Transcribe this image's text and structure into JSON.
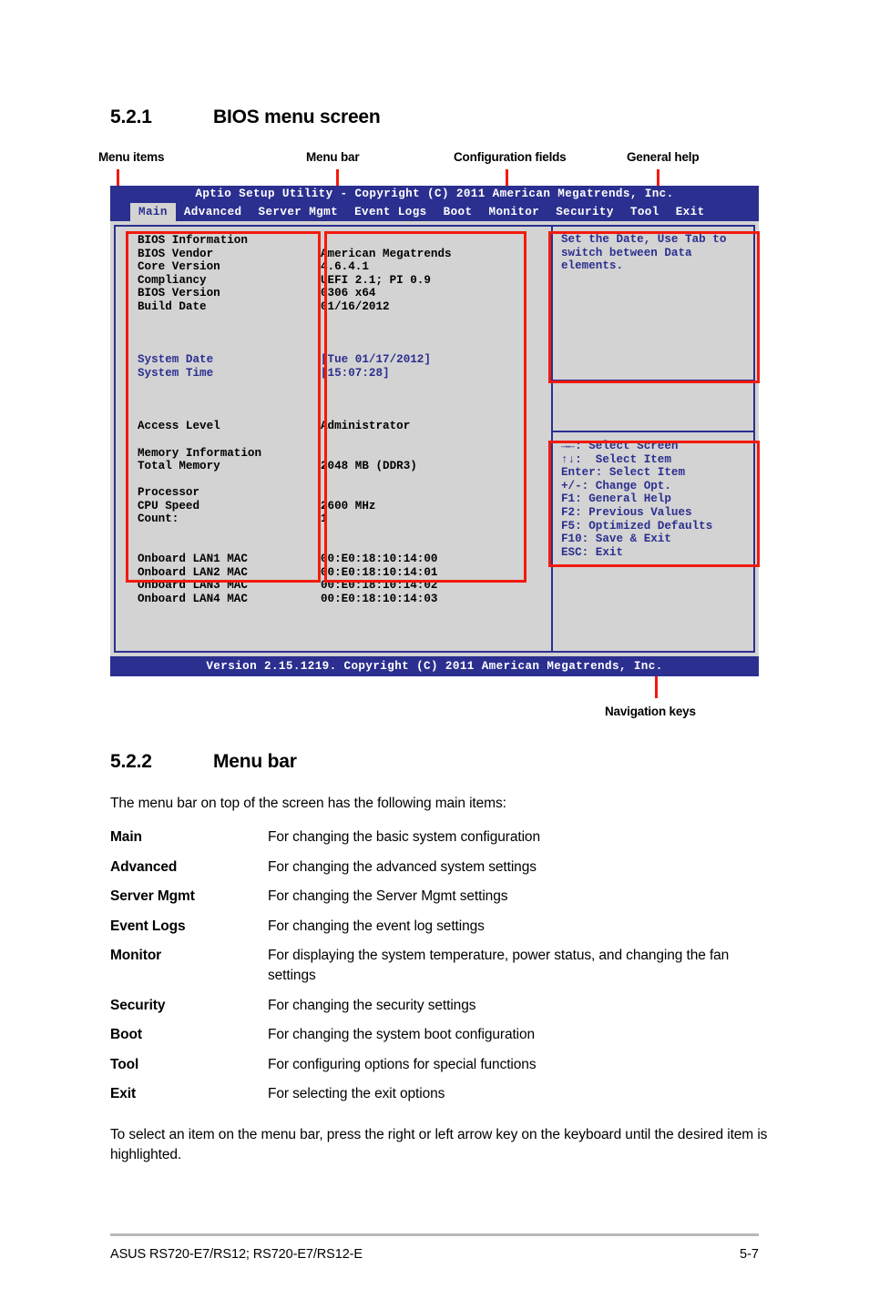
{
  "sections": {
    "s1": {
      "number": "5.2.1",
      "title": "BIOS menu screen"
    },
    "s2": {
      "number": "5.2.2",
      "title": "Menu bar"
    }
  },
  "callouts": {
    "menu_items": "Menu items",
    "menu_bar": "Menu bar",
    "configuration_fields": "Configuration fields",
    "general_help": "General help",
    "navigation_keys": "Navigation keys"
  },
  "bios": {
    "title": "Aptio Setup Utility - Copyright (C) 2011 American Megatrends, Inc.",
    "menu": [
      {
        "label": "Main",
        "active": true
      },
      {
        "label": "Advanced",
        "active": false
      },
      {
        "label": "Server Mgmt",
        "active": false
      },
      {
        "label": "Event Logs",
        "active": false
      },
      {
        "label": "Boot",
        "active": false
      },
      {
        "label": "Monitor",
        "active": false
      },
      {
        "label": "Security",
        "active": false
      },
      {
        "label": "Tool",
        "active": false
      },
      {
        "label": "Exit",
        "active": false
      }
    ],
    "rows": [
      {
        "label": "BIOS Information",
        "value": "",
        "blue": false
      },
      {
        "label": "BIOS Vendor",
        "value": "American Megatrends",
        "blue": false
      },
      {
        "label": "Core Version",
        "value": "4.6.4.1",
        "blue": false
      },
      {
        "label": "Compliancy",
        "value": "UEFI 2.1; PI 0.9",
        "blue": false
      },
      {
        "label": "BIOS Version",
        "value": "0306 x64",
        "blue": false
      },
      {
        "label": "Build Date",
        "value": "01/16/2012",
        "blue": false
      },
      {
        "label": "",
        "value": "",
        "blue": false
      },
      {
        "label": "",
        "value": "",
        "blue": false
      },
      {
        "label": "",
        "value": "",
        "blue": false
      },
      {
        "label": "System Date",
        "value": "[Tue 01/17/2012]",
        "blue": true
      },
      {
        "label": "System Time",
        "value": "[15:07:28]",
        "blue": true
      },
      {
        "label": "",
        "value": "",
        "blue": false
      },
      {
        "label": "",
        "value": "",
        "blue": false
      },
      {
        "label": "",
        "value": "",
        "blue": false
      },
      {
        "label": "Access Level",
        "value": "Administrator",
        "blue": false
      },
      {
        "label": "",
        "value": "",
        "blue": false
      },
      {
        "label": "Memory Information",
        "value": "",
        "blue": false
      },
      {
        "label": "Total Memory",
        "value": "2048 MB (DDR3)",
        "blue": false
      },
      {
        "label": "",
        "value": "",
        "blue": false
      },
      {
        "label": "Processor",
        "value": "",
        "blue": false
      },
      {
        "label": "CPU Speed",
        "value": "2600 MHz",
        "blue": false
      },
      {
        "label": "Count:",
        "value": "1",
        "blue": false
      },
      {
        "label": "",
        "value": "",
        "blue": false
      },
      {
        "label": "",
        "value": "",
        "blue": false
      },
      {
        "label": "Onboard LAN1 MAC",
        "value": "00:E0:18:10:14:00",
        "blue": false
      },
      {
        "label": "Onboard LAN2 MAC",
        "value": "00:E0:18:10:14:01",
        "blue": false
      },
      {
        "label": "Onboard LAN3 MAC",
        "value": "00:E0:18:10:14:02",
        "blue": false
      },
      {
        "label": "Onboard LAN4 MAC",
        "value": "00:E0:18:10:14:03",
        "blue": false
      }
    ],
    "help_text_line1": "Set the Date, Use Tab to",
    "help_text_line2": "switch between Data elements.",
    "nav_keys": [
      "→←: Select Screen",
      "↑↓:  Select Item",
      "Enter: Select Item",
      "+/-: Change Opt.",
      "F1: General Help",
      "F2: Previous Values",
      "F5: Optimized Defaults",
      "F10: Save & Exit",
      "ESC: Exit"
    ],
    "version": "Version 2.15.1219. Copyright (C) 2011 American Megatrends, Inc."
  },
  "menu_bar_section": {
    "intro": "The menu bar on top of the screen has the following main items:",
    "items": [
      {
        "term": "Main",
        "desc": "For changing the basic system configuration"
      },
      {
        "term": "Advanced",
        "desc": "For changing the advanced system settings"
      },
      {
        "term": "Server Mgmt",
        "desc": "For changing the Server Mgmt settings"
      },
      {
        "term": "Event Logs",
        "desc": "For changing the event log settings"
      },
      {
        "term": "Monitor",
        "desc": "For displaying the system temperature, power status, and changing the fan settings"
      },
      {
        "term": "Security",
        "desc": "For changing the security settings"
      },
      {
        "term": "Boot",
        "desc": "For changing the system boot configuration"
      },
      {
        "term": "Tool",
        "desc": "For configuring options for special functions"
      },
      {
        "term": "Exit",
        "desc": "For selecting the exit options"
      }
    ],
    "outro": "To select an item on the menu bar, press the right or left arrow key on the keyboard until the desired item is highlighted."
  },
  "footer": {
    "left": "ASUS RS720-E7/RS12; RS720-E7/RS12-E",
    "page": "5-7"
  },
  "colors": {
    "bios_blue": "#2b2f8f",
    "bios_bg": "#d3d3d3",
    "annotation_red": "#f21a0c"
  }
}
